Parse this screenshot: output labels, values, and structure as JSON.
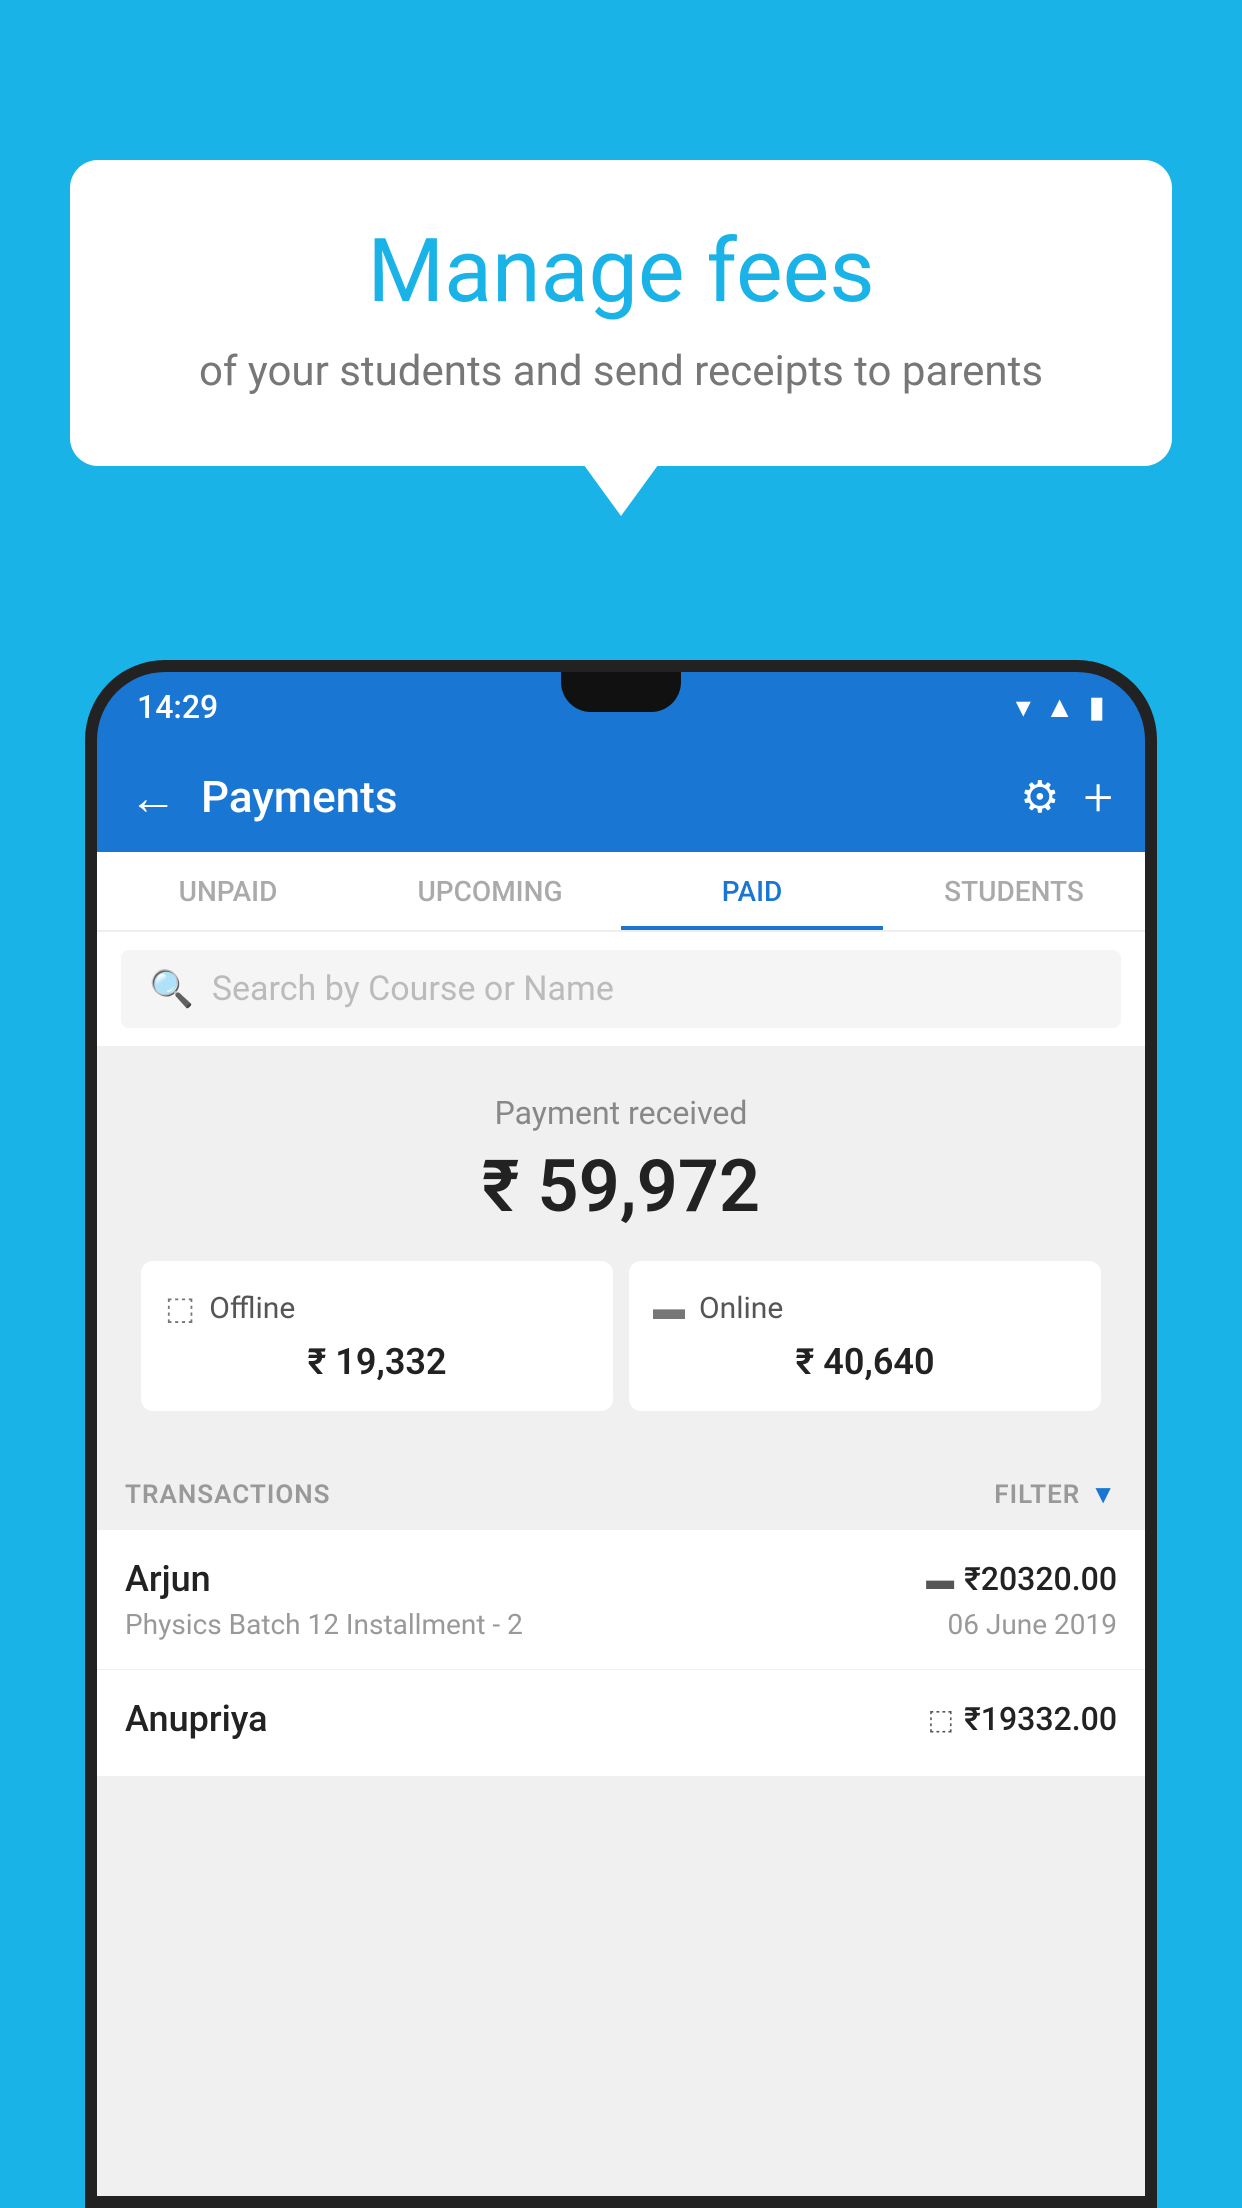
{
  "background_color": "#1ab3e8",
  "speech_bubble": {
    "title": "Manage fees",
    "subtitle": "of your students and send receipts to parents"
  },
  "status_bar": {
    "time": "14:29",
    "icons": [
      "wifi",
      "signal",
      "battery"
    ]
  },
  "app_bar": {
    "title": "Payments",
    "back_label": "←",
    "settings_label": "⚙",
    "add_label": "+"
  },
  "tabs": [
    {
      "id": "unpaid",
      "label": "UNPAID",
      "active": false
    },
    {
      "id": "upcoming",
      "label": "UPCOMING",
      "active": false
    },
    {
      "id": "paid",
      "label": "PAID",
      "active": true
    },
    {
      "id": "students",
      "label": "STUDENTS",
      "active": false
    }
  ],
  "search": {
    "placeholder": "Search by Course or Name"
  },
  "payment_summary": {
    "label": "Payment received",
    "amount": "₹ 59,972",
    "offline_label": "Offline",
    "offline_amount": "₹ 19,332",
    "online_label": "Online",
    "online_amount": "₹ 40,640"
  },
  "transactions_section": {
    "label": "TRANSACTIONS",
    "filter_label": "FILTER"
  },
  "transactions": [
    {
      "name": "Arjun",
      "payment_type": "online",
      "amount": "₹20320.00",
      "course": "Physics Batch 12 Installment - 2",
      "date": "06 June 2019"
    },
    {
      "name": "Anupriya",
      "payment_type": "offline",
      "amount": "₹19332.00",
      "course": "",
      "date": ""
    }
  ]
}
